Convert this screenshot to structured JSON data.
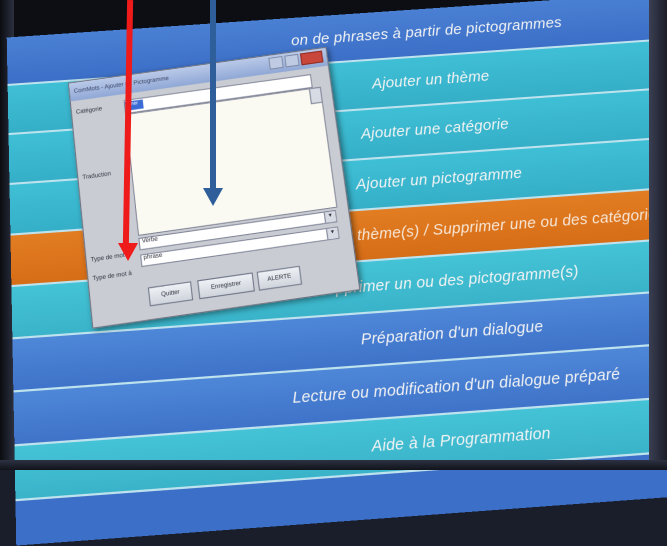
{
  "menu": {
    "items": [
      {
        "label": "on de phrases à partir de pictogrammes",
        "tone": "blue"
      },
      {
        "label": "Ajouter un thème",
        "tone": "cyan"
      },
      {
        "label": "Ajouter une catégorie",
        "tone": "cyan"
      },
      {
        "label": "Ajouter un pictogramme",
        "tone": "cyan"
      },
      {
        "label": "Supprimer un ou des thème(s) / Supprimer une ou des catégorie (s)",
        "tone": "orange"
      },
      {
        "label": "Supprimer un ou des pictogramme(s)",
        "tone": "cyan"
      },
      {
        "label": "Préparation d'un dialogue",
        "tone": "blue"
      },
      {
        "label": "Lecture ou modification d'un dialogue préparé",
        "tone": "blue"
      },
      {
        "label": "Aide à la Programmation",
        "tone": "cyan"
      }
    ]
  },
  "dialog": {
    "title": "ComMots - Ajouter un Pictogramme",
    "labels": {
      "categorie": "Catégorie",
      "traduction": "Traduction",
      "type_mot": "Type de mot",
      "type_mot_2": "Type de mot à"
    },
    "category_value": "Aimer",
    "select_1_value": "Verbe",
    "select_2_value": "phrase",
    "buttons": {
      "quitter": "Quitter",
      "enregistrer": "Enregistrer",
      "alerte": "ALERTE"
    }
  },
  "colors": {
    "arrow_red": "#ef1b1b",
    "arrow_blue": "#2f5f9b",
    "orange_row": "#e27d22",
    "cyan_row": "#3fbfd5",
    "blue_row": "#4a80d4"
  }
}
